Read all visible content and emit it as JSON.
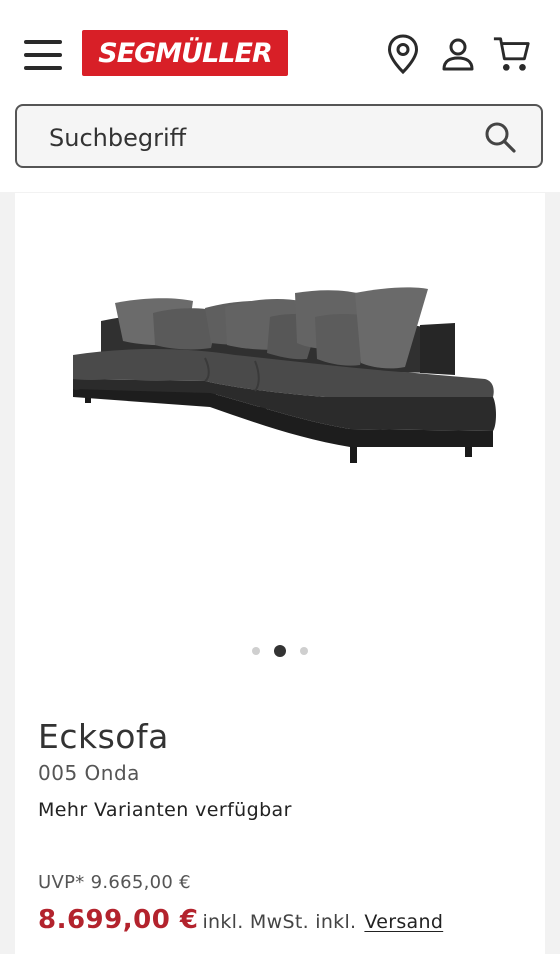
{
  "header": {
    "menu_icon": "hamburger-menu-icon",
    "logo_text": "SEGMÜLLER",
    "brand_color": "#d81f27",
    "icons": [
      "location-pin-icon",
      "user-icon",
      "shopping-cart-icon"
    ]
  },
  "search": {
    "placeholder": "Suchbegriff",
    "icon": "search-icon"
  },
  "product": {
    "image": "corner-sofa-image",
    "carousel": {
      "count": 3,
      "active_index": 1
    },
    "title": "Ecksofa",
    "subtitle": "005 Onda",
    "variants": "Mehr Varianten verfügbar",
    "uvp": "UVP* 9.665,00 €",
    "price": "8.699,00 €",
    "price_color": "#b3232d",
    "tax_note": "inkl. MwSt. inkl.",
    "shipping_link": "Versand"
  }
}
